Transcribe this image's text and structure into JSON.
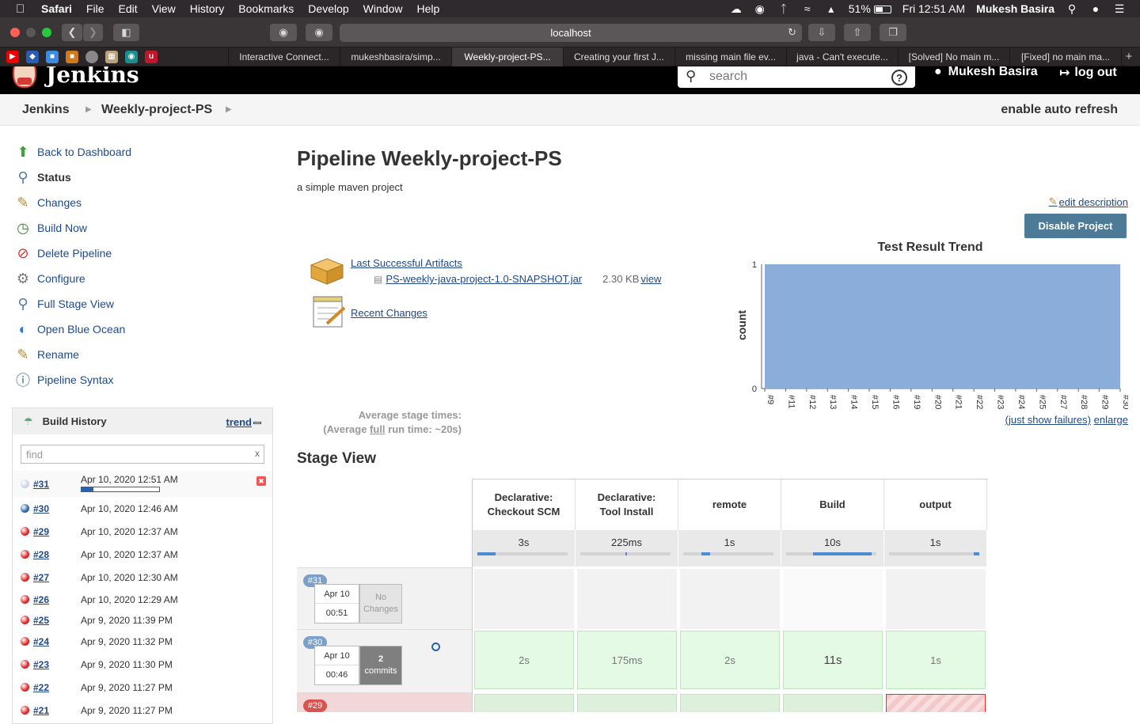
{
  "menubar": {
    "app": "Safari",
    "items": [
      "File",
      "Edit",
      "View",
      "History",
      "Bookmarks",
      "Develop",
      "Window",
      "Help"
    ],
    "battery": "51%",
    "clock": "Fri 12:51 AM",
    "user": "Mukesh Basira"
  },
  "browser": {
    "address": "localhost",
    "tabs": [
      {
        "label": "Interactive Connect..."
      },
      {
        "label": "mukeshbasira/simp..."
      },
      {
        "label": "Weekly-project-PS..."
      },
      {
        "label": "Creating your first J..."
      },
      {
        "label": "missing main file ev..."
      },
      {
        "label": "java - Can't execute..."
      },
      {
        "label": "[Solved] No main m..."
      },
      {
        "label": "[Fixed] no main ma..."
      }
    ]
  },
  "header": {
    "logo": "Jenkins",
    "search_placeholder": "search",
    "user": "Mukesh Basira",
    "logout": "log out"
  },
  "breadcrumb": {
    "items": [
      "Jenkins",
      "Weekly-project-PS"
    ],
    "auto_refresh": "enable auto refresh"
  },
  "sidebar": {
    "tasks": [
      {
        "label": "Back to Dashboard"
      },
      {
        "label": "Status"
      },
      {
        "label": "Changes"
      },
      {
        "label": "Build Now"
      },
      {
        "label": "Delete Pipeline"
      },
      {
        "label": "Configure"
      },
      {
        "label": "Full Stage View"
      },
      {
        "label": "Open Blue Ocean"
      },
      {
        "label": "Rename"
      },
      {
        "label": "Pipeline Syntax"
      }
    ]
  },
  "build_history": {
    "title": "Build History",
    "trend": "trend",
    "find_placeholder": "find",
    "clear": "x",
    "builds": [
      {
        "num": "#31",
        "date": "Apr 10, 2020 12:51 AM",
        "status": "running",
        "progress": 0.15
      },
      {
        "num": "#30",
        "date": "Apr 10, 2020 12:46 AM",
        "status": "success"
      },
      {
        "num": "#29",
        "date": "Apr 10, 2020 12:37 AM",
        "status": "failed"
      },
      {
        "num": "#28",
        "date": "Apr 10, 2020 12:37 AM",
        "status": "failed"
      },
      {
        "num": "#27",
        "date": "Apr 10, 2020 12:30 AM",
        "status": "failed"
      },
      {
        "num": "#26",
        "date": "Apr 10, 2020 12:29 AM",
        "status": "failed"
      },
      {
        "num": "#25",
        "date": "Apr 9, 2020 11:39 PM",
        "status": "failed"
      },
      {
        "num": "#24",
        "date": "Apr 9, 2020 11:32 PM",
        "status": "failed"
      },
      {
        "num": "#23",
        "date": "Apr 9, 2020 11:30 PM",
        "status": "failed"
      },
      {
        "num": "#22",
        "date": "Apr 9, 2020 11:27 PM",
        "status": "failed"
      },
      {
        "num": "#21",
        "date": "Apr 9, 2020 11:27 PM",
        "status": "failed"
      }
    ]
  },
  "main": {
    "title": "Pipeline Weekly-project-PS",
    "description": "a simple maven project",
    "edit_description": "edit description",
    "disable_button": "Disable Project",
    "last_successful_artifacts": "Last Successful Artifacts",
    "artifact": {
      "name": "PS-weekly-java-project-1.0-SNAPSHOT.jar",
      "size": "2.30 KB",
      "view": "view"
    },
    "recent_changes": "Recent Changes",
    "just_show_failures": "(just show failures)",
    "enlarge": "enlarge"
  },
  "chart_data": {
    "type": "area",
    "title": "Test Result Trend",
    "ylabel": "count",
    "xlabel": "",
    "categories": [
      "#9",
      "#11",
      "#12",
      "#13",
      "#14",
      "#15",
      "#16",
      "#19",
      "#20",
      "#21",
      "#22",
      "#23",
      "#24",
      "#25",
      "#27",
      "#28",
      "#29",
      "#30"
    ],
    "values": [
      1,
      1,
      1,
      1,
      1,
      1,
      1,
      1,
      1,
      1,
      1,
      1,
      1,
      1,
      1,
      1,
      1,
      1
    ],
    "ylim": [
      0,
      1
    ],
    "yticks": [
      "0",
      "1"
    ],
    "color": "#8aadd9"
  },
  "stage_view": {
    "title": "Stage View",
    "avg_label_1": "Average stage times:",
    "avg_label_2a": "(Average ",
    "avg_label_full": "full",
    "avg_label_2b": " run time: ~20s)",
    "stages": [
      {
        "name": "Declarative: Checkout SCM",
        "avg": "3s",
        "share": 0.2
      },
      {
        "name": "Declarative: Tool Install",
        "avg": "225ms",
        "share": 0.02
      },
      {
        "name": "remote",
        "avg": "1s",
        "share": 0.1
      },
      {
        "name": "Build",
        "avg": "10s",
        "share": 0.65
      },
      {
        "name": "output",
        "avg": "1s",
        "share": 0.06
      }
    ],
    "runs": [
      {
        "badge": "#31",
        "date": "Apr 10",
        "time": "00:51",
        "changes_line1": "No",
        "changes_line2": "Changes",
        "cells": [
          "",
          "",
          "",
          "",
          ""
        ]
      },
      {
        "badge": "#30",
        "date": "Apr 10",
        "time": "00:46",
        "changes_line1": "2",
        "changes_line2": "commits",
        "cells": [
          "2s",
          "175ms",
          "2s",
          "11s",
          "1s"
        ]
      },
      {
        "badge": "#29"
      }
    ]
  }
}
